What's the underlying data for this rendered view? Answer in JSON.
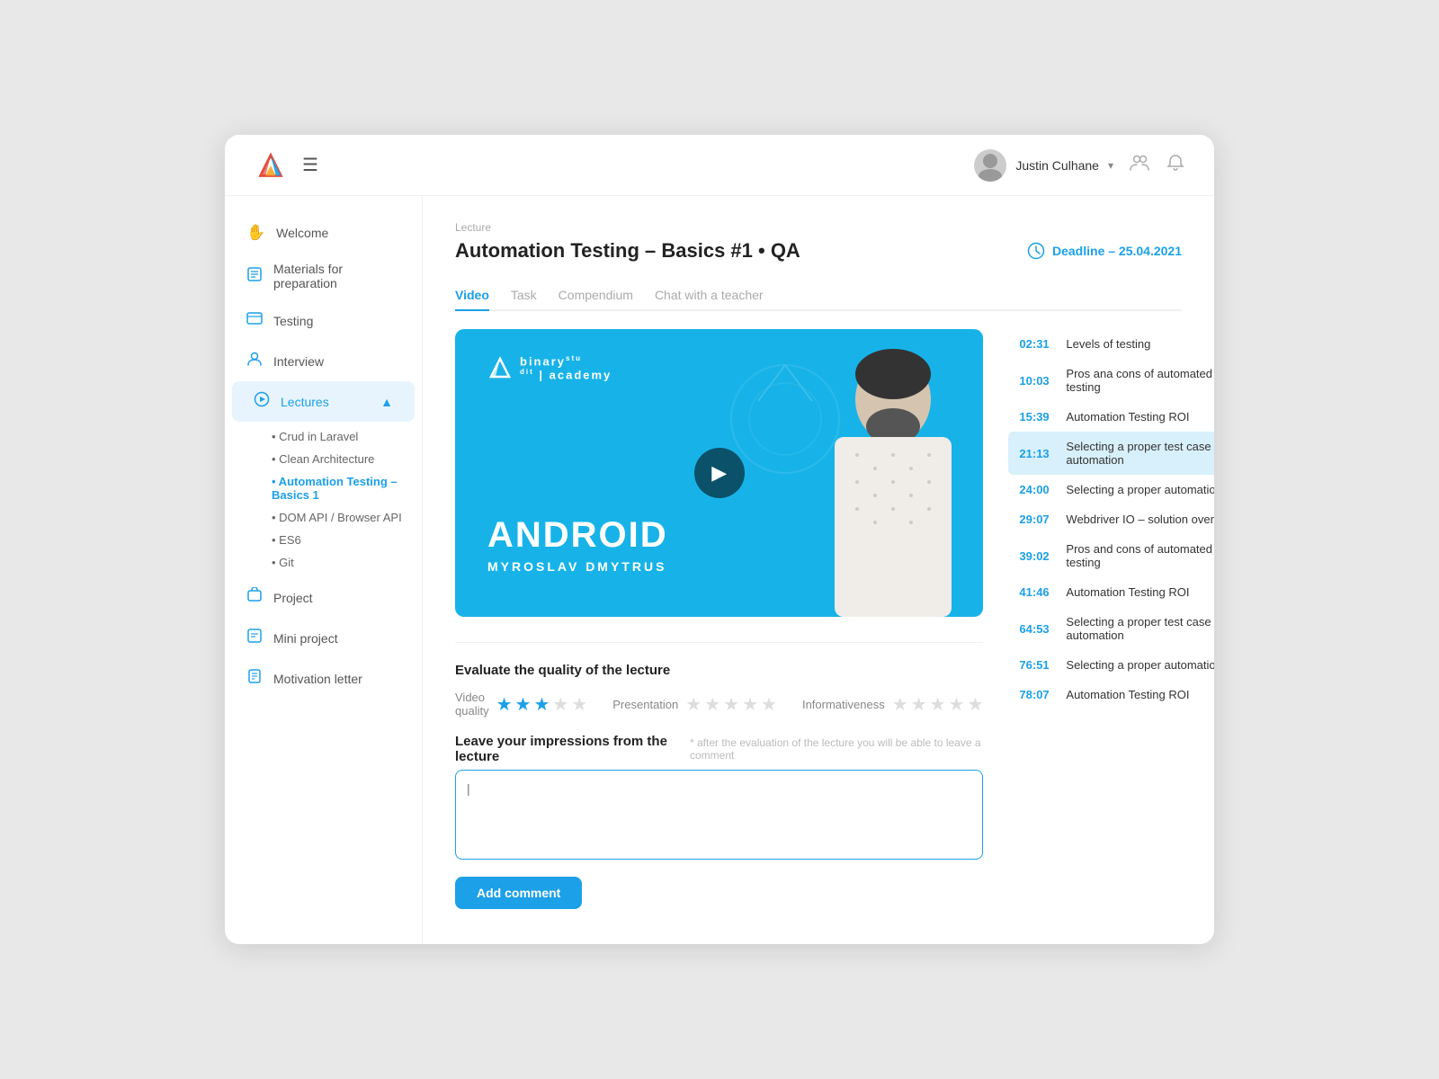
{
  "header": {
    "menu_icon": "☰",
    "user_name": "Justin Culhane",
    "chevron": "▾",
    "icon_users": "👥",
    "icon_bell": "🔔"
  },
  "sidebar": {
    "items": [
      {
        "id": "welcome",
        "label": "Welcome",
        "icon": "✋"
      },
      {
        "id": "materials",
        "label": "Materials for preparation",
        "icon": "📋"
      },
      {
        "id": "testing",
        "label": "Testing",
        "icon": "🖥"
      },
      {
        "id": "interview",
        "label": "Interview",
        "icon": "👤"
      },
      {
        "id": "lectures",
        "label": "Lectures",
        "icon": "▶",
        "active": true
      }
    ],
    "subitems": [
      {
        "label": "• Crud in Laravel",
        "active": false
      },
      {
        "label": "• Clean Architecture",
        "active": false
      },
      {
        "label": "• Automation Testing – Basics 1",
        "active": true
      },
      {
        "label": "• DOM API / Browser API",
        "active": false
      },
      {
        "label": "• ES6",
        "active": false
      },
      {
        "label": "• Git",
        "active": false
      }
    ],
    "bottom_items": [
      {
        "id": "project",
        "label": "Project",
        "icon": "📁"
      },
      {
        "id": "mini-project",
        "label": "Mini project",
        "icon": "📑"
      },
      {
        "id": "motivation",
        "label": "Motivation letter",
        "icon": "📄"
      }
    ]
  },
  "breadcrumb": "Lecture",
  "page_title": "Automation Testing – Basics #1 • QA",
  "deadline": "Deadline – 25.04.2021",
  "tabs": [
    {
      "id": "video",
      "label": "Video",
      "active": true
    },
    {
      "id": "task",
      "label": "Task",
      "active": false
    },
    {
      "id": "compendium",
      "label": "Compendium",
      "active": false
    },
    {
      "id": "chat",
      "label": "Chat with a teacher",
      "active": false
    }
  ],
  "video": {
    "brand": "binary",
    "brand_sup": "stu\ndit",
    "brand_separator": "|",
    "brand_academy": "academy",
    "title": "ANDROID",
    "subtitle": "MYROSLAV DMYTRUS",
    "play_icon": "▶"
  },
  "playlist": [
    {
      "time": "02:31",
      "label": "Levels of testing",
      "active": false
    },
    {
      "time": "10:03",
      "label": "Pros ana cons of automated GUI testing",
      "active": false
    },
    {
      "time": "15:39",
      "label": "Automation Testing ROI",
      "active": false
    },
    {
      "time": "21:13",
      "label": "Selecting a proper test case for automation",
      "active": true
    },
    {
      "time": "24:00",
      "label": "Selecting a proper automation tool",
      "active": false
    },
    {
      "time": "29:07",
      "label": "Webdriver IO – solution overview",
      "active": false
    },
    {
      "time": "39:02",
      "label": "Pros and cons of automated GUI testing",
      "active": false
    },
    {
      "time": "41:46",
      "label": "Automation Testing ROI",
      "active": false
    },
    {
      "time": "64:53",
      "label": "Selecting a proper test case for automation",
      "active": false
    },
    {
      "time": "76:51",
      "label": "Selecting a proper automation tool",
      "active": false
    },
    {
      "time": "78:07",
      "label": "Automation Testing ROI",
      "active": false
    }
  ],
  "rating": {
    "title": "Evaluate the quality of the lecture",
    "groups": [
      {
        "label": "Video quality",
        "filled": 3,
        "total": 5
      },
      {
        "label": "Presentation",
        "filled": 0,
        "total": 5
      },
      {
        "label": "Informativeness",
        "filled": 0,
        "total": 5
      }
    ]
  },
  "impressions": {
    "title": "Leave your impressions from the lecture",
    "hint": "* after the evaluation of the lecture you will be able to leave a comment",
    "placeholder": "|",
    "add_button": "Add comment"
  }
}
